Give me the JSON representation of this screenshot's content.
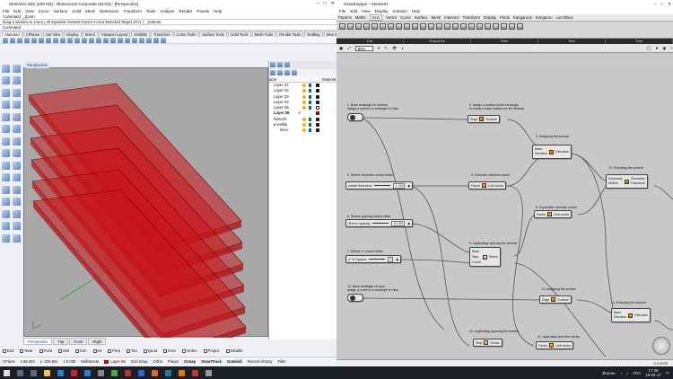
{
  "rhino": {
    "title": "Shelve01.3dm (400 KB) - Rhinoceros Corporate (64-bit) - [Perspective]",
    "menu": [
      "File",
      "Edit",
      "View",
      "Curve",
      "Surface",
      "Solid",
      "Mesh",
      "Dimension",
      "Transform",
      "Tools",
      "Analyze",
      "Render",
      "Panels",
      "Help"
    ],
    "cmd_history": [
      "Command: _Zoom",
      "Drag a window to zoom ( All  Dynamic  Extents  Factor  In  Out  Selected  Target  1To1 ): _Extents"
    ],
    "cmd_prompt": "Command:",
    "tabs": [
      "Standard",
      "CPlanes",
      "Set View",
      "Display",
      "Select",
      "Viewport Layout",
      "Visibility",
      "Transform",
      "Curve Tools",
      "Surface Tools",
      "Solid Tools",
      "Mesh Tools",
      "Render Tools",
      "Drafting",
      "New in V"
    ],
    "viewport_label": "Perspective",
    "viewport_tabs": [
      "Perspective",
      "Top",
      "Front",
      "Right"
    ],
    "layers_header_left": "ame",
    "layers_header_right": "Material",
    "layers": [
      {
        "name": "Layer 01",
        "color": "#000000"
      },
      {
        "name": "Layer 02",
        "color": "#000000"
      },
      {
        "name": "Layer 03",
        "color": "#000000"
      },
      {
        "name": "Layer 04",
        "color": "#000000"
      },
      {
        "name": "Layer 05",
        "color": "#000000"
      },
      {
        "name": "Layer 06",
        "color": "#cc0000"
      },
      {
        "name": "Rdss20",
        "color": "#000000"
      },
      {
        "name": "visible",
        "color": "#000000"
      },
      {
        "name": "lines",
        "color": "#000000"
      }
    ],
    "osnaps": [
      "End",
      "Near",
      "Point",
      "Mid",
      "Cen",
      "Int",
      "Perp",
      "Tan",
      "Quad",
      "Knot",
      "Vertex",
      "Project",
      "Disable"
    ],
    "status": [
      "CPlane",
      "x 58.062",
      "y -226.661",
      "z 0.000",
      "Millimeters",
      "Layer 06",
      "Grid Snap",
      "Ortho",
      "Planar",
      "Osnap",
      "SmartTrack",
      "Gumball",
      "Record History",
      "Filter"
    ]
  },
  "gh": {
    "title": "Grasshopper - Shelve01",
    "menu": [
      "File",
      "Edit",
      "View",
      "Display",
      "Solution",
      "Help"
    ],
    "tabs": [
      "Params",
      "Maths",
      "Sets",
      "Vector",
      "Curve",
      "Surface",
      "Mesh",
      "Intersect",
      "Transform",
      "Display",
      "Pinds",
      "Kangaroo2",
      "Kangaroo",
      "LunchBox"
    ],
    "groups": [
      "List",
      "Sequence",
      "Sets",
      "Text",
      "Tree"
    ],
    "zoom": "89%",
    "notes": {
      "n1": [
        "1. Base rectangle for shelves",
        "assign a curve to a rectangle in rhino"
      ],
      "n2": [
        "2. Assign a surface to the rectangle",
        "to create a base surface for the shelves"
      ],
      "n3": [
        "3. Assigning the surface"
      ],
      "n4": [
        "4. Extrusion direction vector"
      ],
      "n5": [
        "5. Shelve thickness control slider"
      ],
      "n6": [
        "6. Shelve spacing control slider"
      ],
      "n7": [
        "7. Shelve n° control slider"
      ],
      "n8": [
        "8. Duplication direction vector"
      ],
      "n9": [
        "9. duplicating/ spacing  the shelves"
      ],
      "n10": [
        "10. Extruding the surface"
      ],
      "n11": [
        "11. duplication direction vector"
      ],
      "n12": [
        "12. Base rectangle for tops",
        "assign a curve to a rectangle in rhino"
      ],
      "n13": [
        "13. Assigning the surface"
      ],
      "n14": [
        "14. Extruding the surface"
      ],
      "n16": [
        "16. duplicating/ spacing  the shelves"
      ]
    },
    "comps": {
      "edge": "Edge",
      "surface": "Surface",
      "base": "Base",
      "direction": "Direction",
      "extrusion": "Extrusion",
      "factor": "Factor",
      "unit_vector": "Unit vector",
      "geometry": "Geometry",
      "motion": "Motion",
      "transform": "Transform",
      "base2": "Base",
      "step": "Step",
      "count": "Count",
      "series": "Series",
      "factor2": "Factor",
      "unit_vector2": "Unit vector"
    },
    "sliders": {
      "thickness": {
        "label": "shelve thickness",
        "value": "3.155"
      },
      "spacing": {
        "label": "Shelve spacing",
        "value": "15.289"
      },
      "count": {
        "label": "n° of Spaces",
        "value": "5"
      }
    },
    "status_text": "0.9.0076"
  },
  "taskbar": {
    "app": "Bureau",
    "lang": "FRA",
    "time": "17:36",
    "date": "15-02-17"
  }
}
